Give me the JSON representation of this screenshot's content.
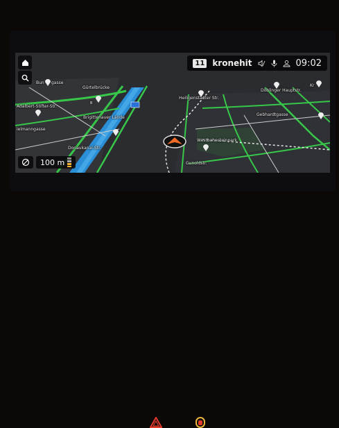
{
  "status": {
    "preset": "11",
    "station": "kronehit",
    "time": "09:02"
  },
  "map": {
    "scale": "100 m",
    "route_badge": "B",
    "labels": {
      "gurtelbrucke": "Gürtelbrücke",
      "adalbert": "Adalbert-Stifter-Str.",
      "brigitten": "Brigittenauer Lände",
      "donaukanal": "Donaukanal-Str.",
      "heiligenstaedter": "Heiligenstädter Str.",
      "doblinger": "Döblinger Hauptstr.",
      "gebhardt": "Gebhardtgasse",
      "westbahn": "Westbahnsteinpark",
      "gunold": "Gunoldstr.",
      "bun": "Bun",
      "gasse1": "gasse",
      "manngasse": "ielmanngasse",
      "kr": "Kr"
    }
  },
  "icons": {
    "home": "home-icon",
    "search": "search-icon",
    "mute": "mute-icon",
    "mic": "microphone-icon",
    "user": "user-icon",
    "speaker_off": "speaker-muted-icon"
  },
  "colors": {
    "road_major": "#37c84a",
    "water": "#2b8fd8",
    "arrow": "#f06a2a",
    "screen_bg": "#2a2b2e"
  }
}
